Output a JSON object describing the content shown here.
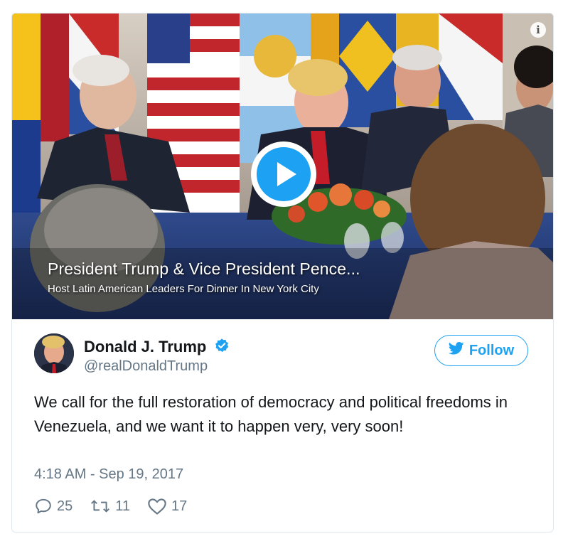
{
  "video": {
    "caption_title": "President Trump & Vice President Pence...",
    "caption_subtitle": "Host Latin American Leaders For Dinner In New York City",
    "info_icon": "info-icon",
    "play_icon": "play-icon"
  },
  "author": {
    "name": "Donald J. Trump",
    "handle": "@realDonaldTrump",
    "verified_icon": "verified-badge-icon",
    "avatar_icon": "avatar"
  },
  "follow": {
    "label": "Follow",
    "icon": "twitter-bird-icon",
    "color": "#1da1f2"
  },
  "tweet": {
    "text": "We call for the full restoration of democracy and political freedoms in Venezuela, and we want it to happen very, very soon!",
    "timestamp": "4:18 AM - Sep 19, 2017"
  },
  "actions": {
    "replies": "25",
    "retweets": "11",
    "likes": "17"
  },
  "colors": {
    "accent": "#1da1f2",
    "muted": "#657786",
    "text": "#14171a"
  }
}
